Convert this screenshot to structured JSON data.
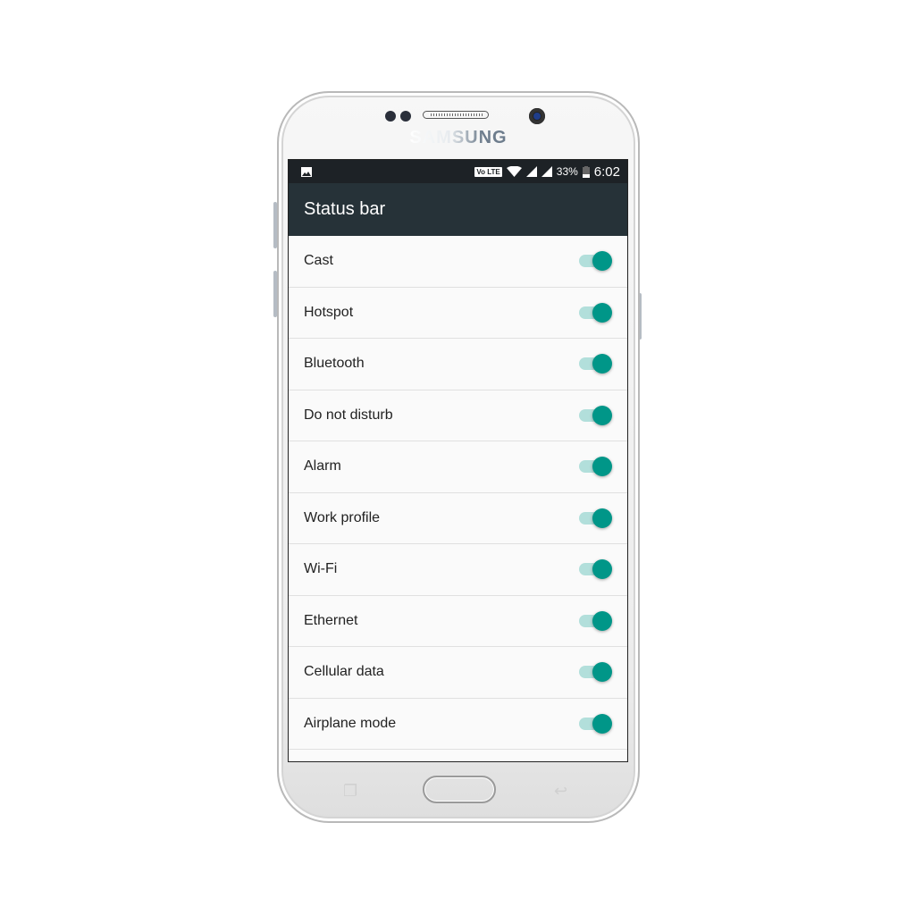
{
  "device": {
    "brand": "SAMSUNG"
  },
  "status_bar": {
    "volte": "Vo LTE",
    "battery": "33%",
    "time": "6:02",
    "icons": [
      "image-icon",
      "wifi-icon",
      "signal-icon",
      "signal-icon",
      "battery-icon"
    ]
  },
  "app_bar": {
    "title": "Status bar"
  },
  "items": [
    {
      "label": "Cast",
      "enabled": true
    },
    {
      "label": "Hotspot",
      "enabled": true
    },
    {
      "label": "Bluetooth",
      "enabled": true
    },
    {
      "label": "Do not disturb",
      "enabled": true
    },
    {
      "label": "Alarm",
      "enabled": true
    },
    {
      "label": "Work profile",
      "enabled": true
    },
    {
      "label": "Wi-Fi",
      "enabled": true
    },
    {
      "label": "Ethernet",
      "enabled": true
    },
    {
      "label": "Cellular data",
      "enabled": true
    },
    {
      "label": "Airplane mode",
      "enabled": true
    }
  ],
  "colors": {
    "accent": "#009688",
    "track": "#b2dfdb",
    "app_bar": "#263238",
    "status_bar": "#1d2226"
  }
}
